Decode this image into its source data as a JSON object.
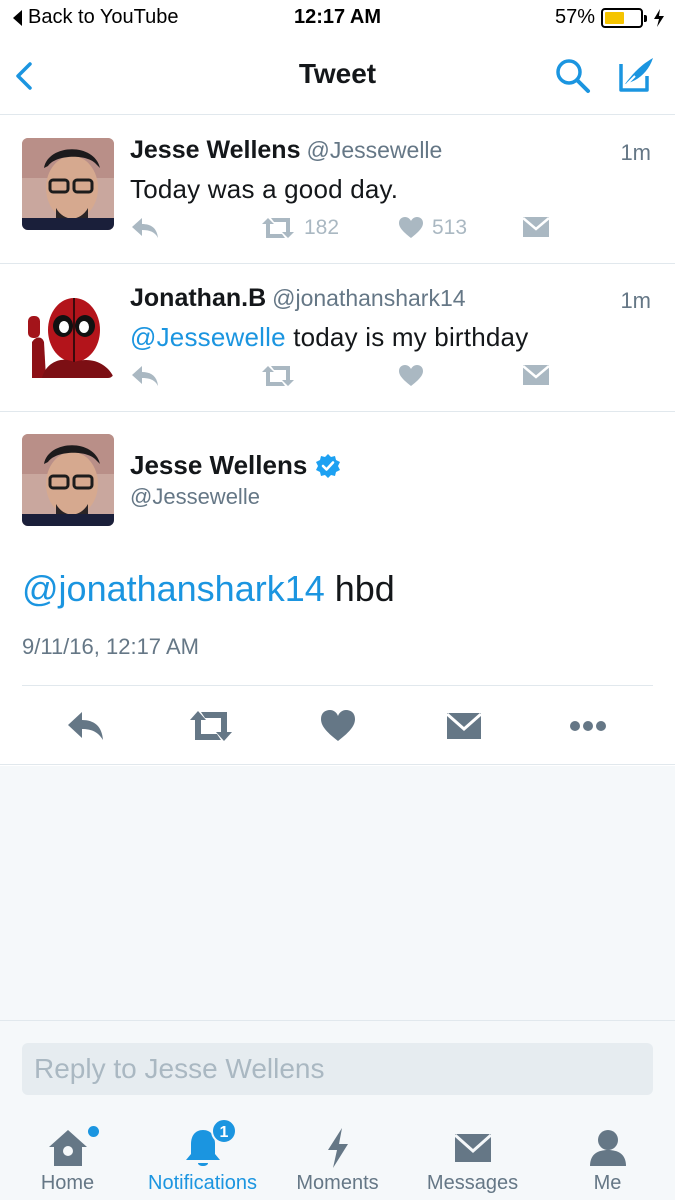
{
  "status_bar": {
    "back_app": "Back to YouTube",
    "time": "12:17 AM",
    "battery_percent": "57%",
    "battery_level": 0.57,
    "battery_color": "#f5c400"
  },
  "nav": {
    "title": "Tweet",
    "back_icon": "chevron-left-icon",
    "search_icon": "search-icon",
    "compose_icon": "compose-icon"
  },
  "accent_color": "#1b95e0",
  "tweets": [
    {
      "name": "Jesse Wellens",
      "handle": "@Jessewelle",
      "time": "1m",
      "text": "Today was a good day.",
      "retweets": "182",
      "likes": "513"
    },
    {
      "name": "Jonathan.B",
      "handle": "@jonathanshark14",
      "time": "1m",
      "mention": "@Jessewelle",
      "text": " today is my birthday",
      "retweets": "",
      "likes": ""
    }
  ],
  "focused_tweet": {
    "name": "Jesse Wellens",
    "verified": true,
    "handle": "@Jessewelle",
    "mention": "@jonathanshark14",
    "text": " hbd",
    "date": "9/11/16, 12:17 AM"
  },
  "reply": {
    "placeholder": "Reply to Jesse Wellens"
  },
  "tabs": [
    {
      "label": "Home",
      "icon": "home-icon",
      "active": false,
      "has_dot": true
    },
    {
      "label": "Notifications",
      "icon": "bell-icon",
      "active": true,
      "badge": "1"
    },
    {
      "label": "Moments",
      "icon": "lightning-icon",
      "active": false
    },
    {
      "label": "Messages",
      "icon": "envelope-icon",
      "active": false
    },
    {
      "label": "Me",
      "icon": "person-icon",
      "active": false
    }
  ]
}
